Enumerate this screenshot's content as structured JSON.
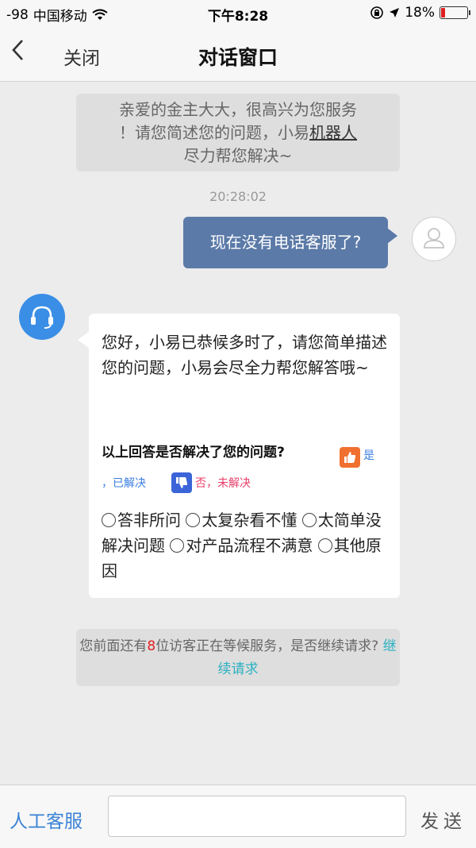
{
  "status_bar": {
    "signal": "-98",
    "carrier": "中国移动",
    "time": "下午8:28",
    "battery_percent": "18%",
    "battery_level": 0.18,
    "icons": [
      "wifi-icon",
      "lock-rotation-icon",
      "location-arrow-icon",
      "battery-icon"
    ]
  },
  "nav": {
    "back_icon": "chevron-left-icon",
    "close_label": "关闭",
    "title": "对话窗口"
  },
  "chat": {
    "system_message": {
      "line1": "亲爱的金主大大，很高兴为您服务",
      "line2_prefix": "！请您简述您的问题，小易",
      "line2_underlined": "机器人",
      "line3": "尽力帮您解决~"
    },
    "timestamp": "20:28:02",
    "user_message": "现在没有电话客服了?",
    "bot_message": {
      "text": "您好，小易已恭候多时了，请您简单描述您的问题，小易会尽全力帮您解答哦~",
      "feedback_question": "以上回答是否解决了您的问题?",
      "yes_label_part1": "是",
      "yes_label_part2": "，已解决",
      "no_label": "否，未解决",
      "reasons": [
        "答非所问",
        "太复杂看不懂",
        "太简单没解决问题",
        "对产品流程不满意",
        "其他原因"
      ]
    },
    "queue_notice": {
      "prefix": "您前面还有",
      "count": "8",
      "middle": "位访客正在等候服务，是否继续请求?",
      "link": "继续请求"
    }
  },
  "input_bar": {
    "human_agent_label": "人工客服",
    "input_value": "",
    "send_label": "发送"
  },
  "colors": {
    "user_bubble": "#5b7aa8",
    "bot_avatar": "#3a8ee6",
    "link": "#2bb0c2",
    "highlight_count": "#e02020",
    "human_agent": "#3a82d6"
  }
}
